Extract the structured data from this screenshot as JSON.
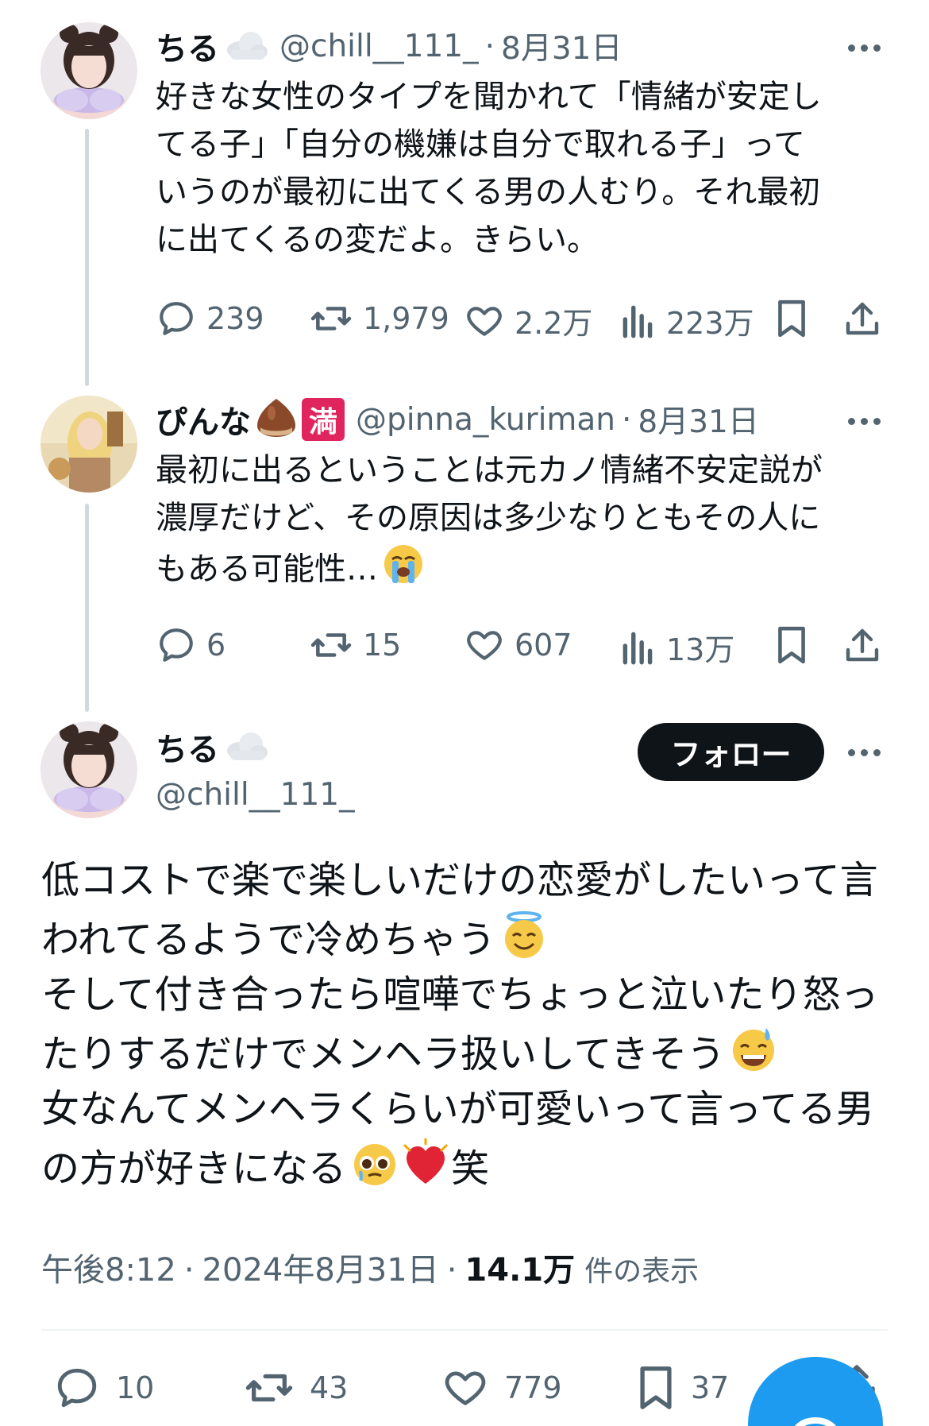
{
  "reply1": {
    "name": "ちる",
    "name_emoji": "cloud-emoji",
    "handle": "@chill__111_",
    "separator": "·",
    "date": "8月31日",
    "text_lines": [
      "好きな女性のタイプを聞かれて「情緒が安定し",
      "てる子」「自分の機嫌は自分で取れる子」って",
      "いうのが最初に出てくる男の人むり。それ最初",
      "に出てくるの変だよ。きらい。"
    ],
    "stats": {
      "replies": "239",
      "reposts": "1,979",
      "likes": "2.2万",
      "views": "223万"
    }
  },
  "reply2": {
    "name": "ぴんな",
    "name_emoji": "chestnut-emoji",
    "badge": "満",
    "handle": "@pinna_kuriman",
    "separator": "·",
    "date": "8月31日",
    "text_lines": [
      "最初に出るということは元カノ情緒不安定説が",
      "濃厚だけど、その原因は多少なりともその人に",
      "もある可能性…"
    ],
    "stats": {
      "replies": "6",
      "reposts": "15",
      "likes": "607",
      "views": "13万"
    }
  },
  "main": {
    "name": "ちる",
    "handle": "@chill__111_",
    "follow_label": "フォロー",
    "text_lines": [
      "低コストで楽で楽しいだけの恋愛がしたいって言",
      "われてるようで冷めちゃう",
      "そして付き合ったら喧嘩でちょっと泣いたり怒っ",
      "たりするだけでメンヘラ扱いしてきそう",
      "女なんてメンヘラくらいが可愛いって言ってる男",
      "の方が好きになる",
      "笑"
    ],
    "time": "午後8:12",
    "separator": "·",
    "date": "2024年8月31日",
    "views_count": "14.1万",
    "views_label": "件の表示",
    "stats": {
      "replies": "10",
      "reposts": "43",
      "likes": "779",
      "bookmarks": "37"
    }
  },
  "colors": {
    "text": "#0f1419",
    "secondary": "#536471",
    "accent": "#1d9bf0",
    "badge": "#e0245e"
  }
}
